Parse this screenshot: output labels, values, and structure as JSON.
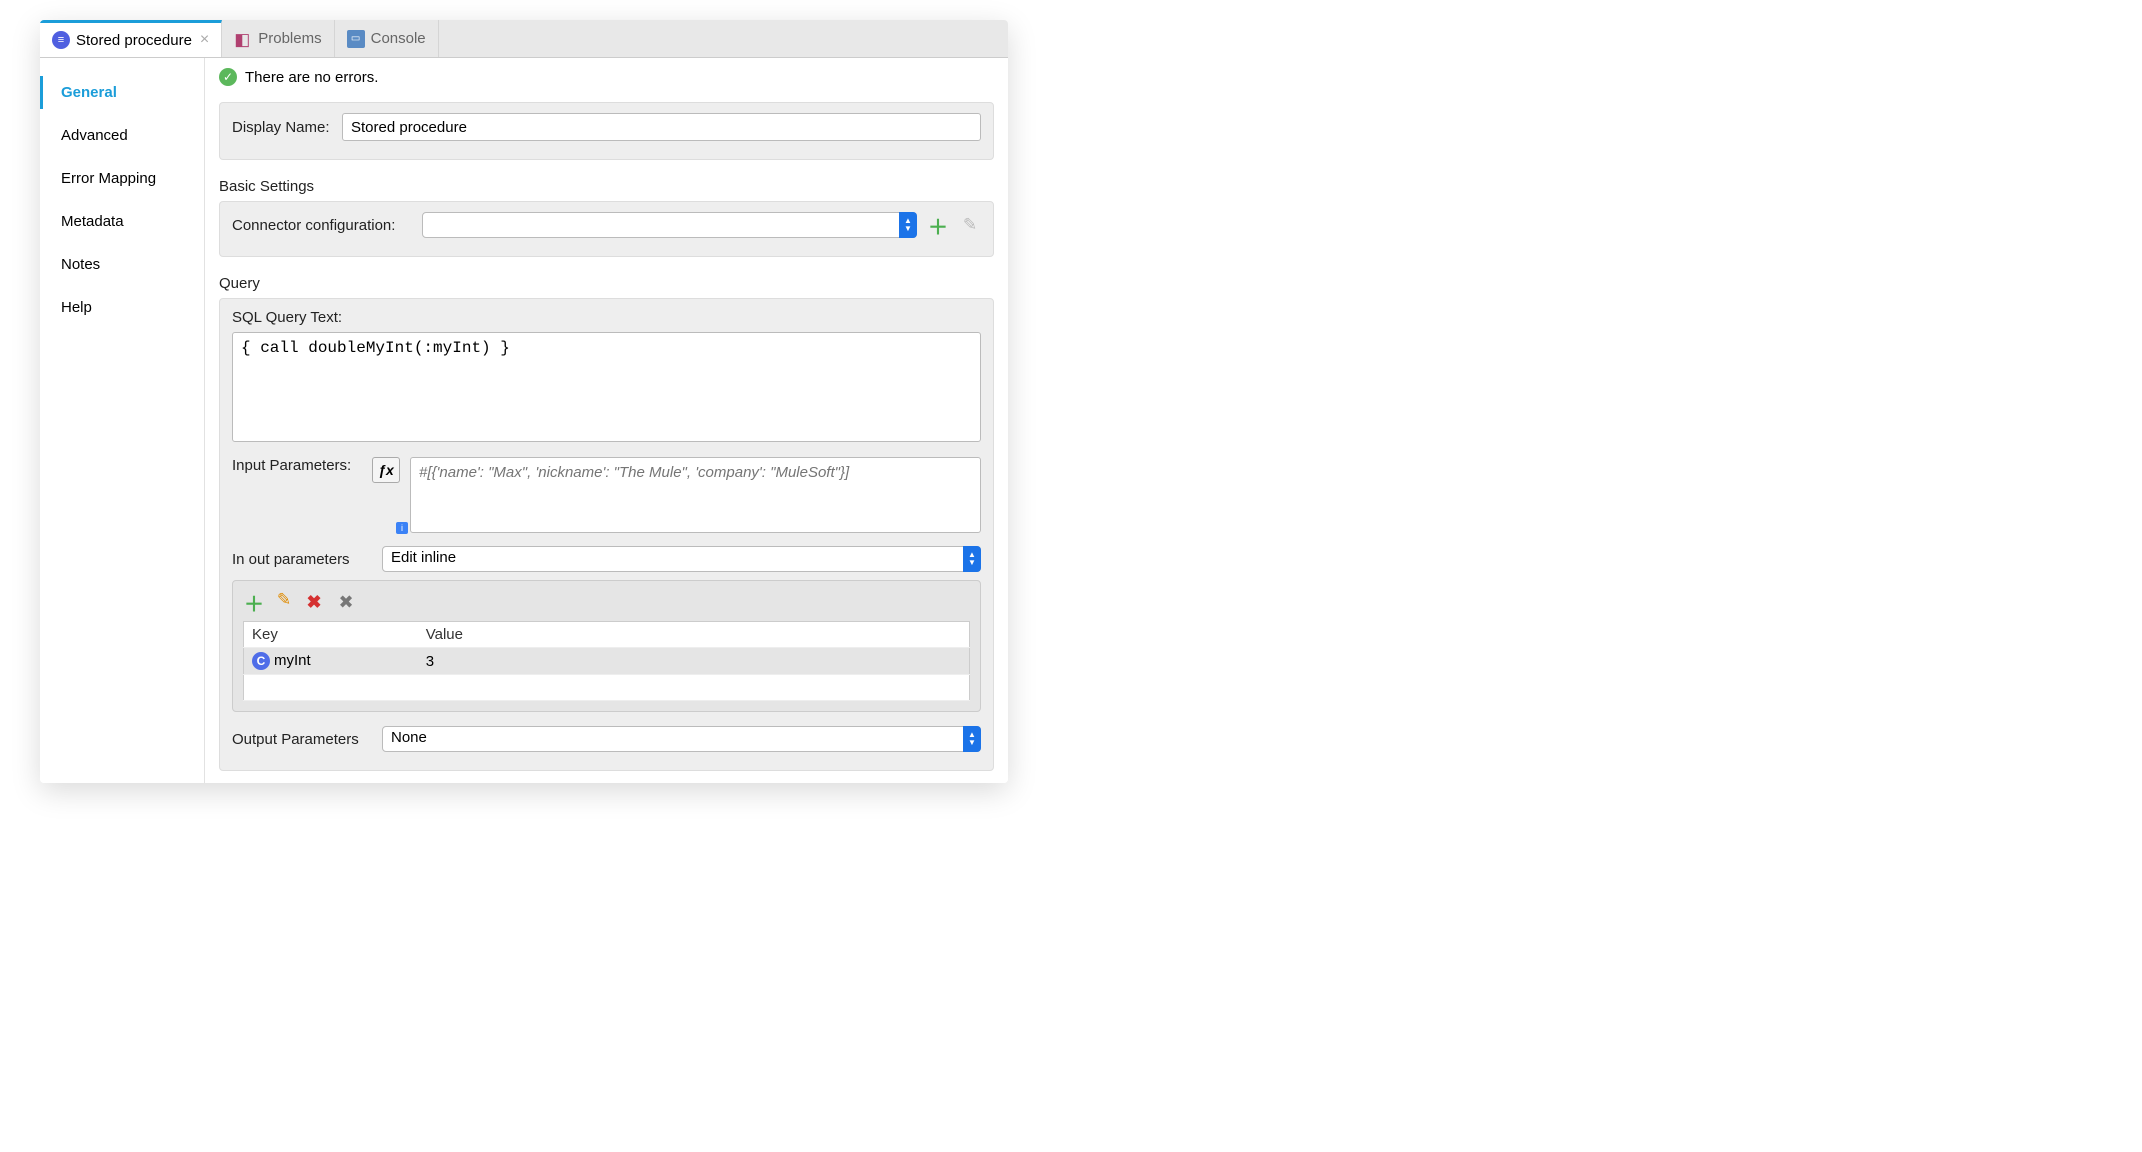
{
  "tabs": [
    {
      "label": "Stored procedure",
      "active": true,
      "closeable": true
    },
    {
      "label": "Problems",
      "active": false
    },
    {
      "label": "Console",
      "active": false
    }
  ],
  "sidebar": {
    "items": [
      {
        "label": "General",
        "active": true
      },
      {
        "label": "Advanced"
      },
      {
        "label": "Error Mapping"
      },
      {
        "label": "Metadata"
      },
      {
        "label": "Notes"
      },
      {
        "label": "Help"
      }
    ]
  },
  "status": {
    "text": "There are no errors."
  },
  "displayName": {
    "label": "Display Name:",
    "value": "Stored procedure"
  },
  "basicSettings": {
    "title": "Basic Settings",
    "connectorConfig": {
      "label": "Connector configuration:",
      "value": ""
    }
  },
  "query": {
    "title": "Query",
    "sqlLabel": "SQL Query Text:",
    "sqlValue": "{ call doubleMyInt(:myInt) }",
    "inputParamsLabel": "Input Parameters:",
    "inputParamsPlaceholder": "#[{'name': \"Max\", 'nickname': \"The Mule\", 'company': \"MuleSoft\"}]",
    "inOutLabel": "In out parameters",
    "inOutSelect": "Edit inline",
    "table": {
      "headers": [
        "Key",
        "Value"
      ],
      "rows": [
        {
          "key": "myInt",
          "value": "3"
        }
      ]
    },
    "outputParamsLabel": "Output Parameters",
    "outputParamsSelect": "None"
  }
}
